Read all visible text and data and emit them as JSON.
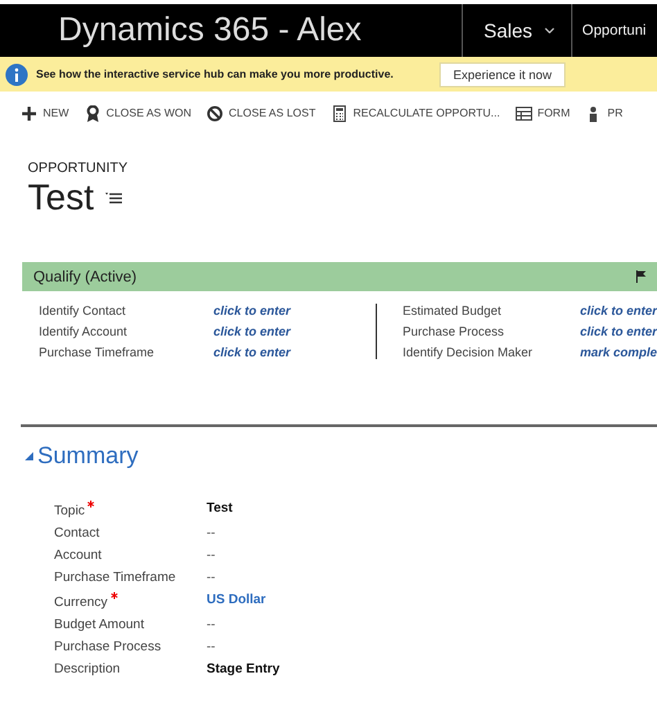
{
  "top_bar": {
    "title": "Dynamics 365 - Alex",
    "nav": [
      {
        "label": "Sales",
        "dropdown": true
      },
      {
        "label": "Opportuni"
      }
    ]
  },
  "banner": {
    "message": "See how the interactive service hub can make you more productive.",
    "button": "Experience it now"
  },
  "commands": [
    {
      "label": "NEW"
    },
    {
      "label": "CLOSE AS WON"
    },
    {
      "label": "CLOSE AS LOST"
    },
    {
      "label": "RECALCULATE OPPORTU..."
    },
    {
      "label": "FORM"
    },
    {
      "label": "PR"
    }
  ],
  "record": {
    "entity": "OPPORTUNITY",
    "name": "Test"
  },
  "process": {
    "stage": "Qualify (Active)",
    "left": [
      {
        "label": "Identify Contact",
        "value": "click to enter"
      },
      {
        "label": "Identify Account",
        "value": "click to enter"
      },
      {
        "label": "Purchase Timeframe",
        "value": "click to enter"
      }
    ],
    "right": [
      {
        "label": "Estimated Budget",
        "value": "click to enter"
      },
      {
        "label": "Purchase Process",
        "value": "click to enter"
      },
      {
        "label": "Identify Decision Maker",
        "value": "mark comple"
      }
    ]
  },
  "summary": {
    "title": "Summary",
    "expanded": true,
    "fields": [
      {
        "label": "Topic",
        "required": true,
        "value": "Test",
        "kind": "text"
      },
      {
        "label": "Contact",
        "required": false,
        "value": "--",
        "kind": "empty"
      },
      {
        "label": "Account",
        "required": false,
        "value": "--",
        "kind": "empty"
      },
      {
        "label": "Purchase Timeframe",
        "required": false,
        "value": "--",
        "kind": "empty"
      },
      {
        "label": "Currency",
        "required": true,
        "value": "US Dollar",
        "kind": "link"
      },
      {
        "label": "Budget Amount",
        "required": false,
        "value": "--",
        "kind": "empty"
      },
      {
        "label": "Purchase Process",
        "required": false,
        "value": "--",
        "kind": "empty"
      },
      {
        "label": "Description",
        "required": false,
        "value": "Stage Entry",
        "kind": "text"
      }
    ]
  }
}
